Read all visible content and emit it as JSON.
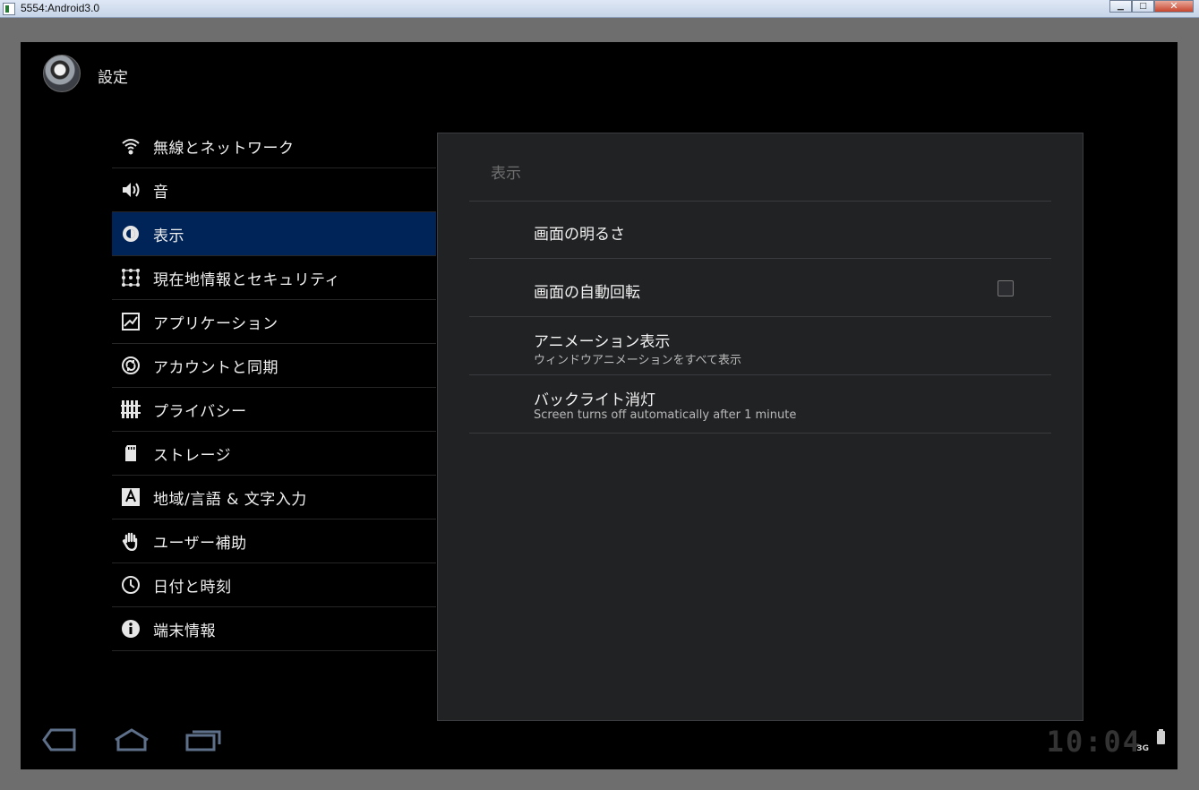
{
  "window": {
    "title": "5554:Android3.0",
    "controls": [
      "minimize",
      "maximize",
      "close"
    ]
  },
  "actionbar": {
    "title": "設定",
    "icon": "settings-app-icon"
  },
  "sidebar": {
    "items": [
      {
        "label": "無線とネットワーク",
        "icon": "wifi-icon",
        "selected": false
      },
      {
        "label": "音",
        "icon": "speaker-icon",
        "selected": false
      },
      {
        "label": "表示",
        "icon": "brightness-icon",
        "selected": true
      },
      {
        "label": "現在地情報とセキュリティ",
        "icon": "lock-pattern-icon",
        "selected": false
      },
      {
        "label": "アプリケーション",
        "icon": "applications-icon",
        "selected": false
      },
      {
        "label": "アカウントと同期",
        "icon": "sync-icon",
        "selected": false
      },
      {
        "label": "プライバシー",
        "icon": "privacy-icon",
        "selected": false
      },
      {
        "label": "ストレージ",
        "icon": "sd-card-icon",
        "selected": false
      },
      {
        "label": "地域/言語 & 文字入力",
        "icon": "language-icon",
        "selected": false
      },
      {
        "label": "ユーザー補助",
        "icon": "accessibility-hand-icon",
        "selected": false
      },
      {
        "label": "日付と時刻",
        "icon": "clock-icon",
        "selected": false
      },
      {
        "label": "端末情報",
        "icon": "info-icon",
        "selected": false
      }
    ]
  },
  "panel": {
    "header": "表示",
    "prefs": [
      {
        "title": "画面の明るさ",
        "summary": ""
      },
      {
        "title": "画面の自動回転",
        "summary": "",
        "checkbox": false
      },
      {
        "title": "アニメーション表示",
        "summary": "ウィンドウアニメーションをすべて表示"
      },
      {
        "title": "バックライト消灯",
        "summary": "Screen turns off automatically after 1 minute"
      }
    ]
  },
  "navbar": {
    "buttons": [
      "back-icon",
      "home-icon",
      "recent-apps-icon"
    ],
    "clock": "10:04",
    "network": "3G"
  },
  "colors": {
    "selected_bg": "#002457",
    "panel_bg": "#212224",
    "screen_bg": "#000000"
  }
}
